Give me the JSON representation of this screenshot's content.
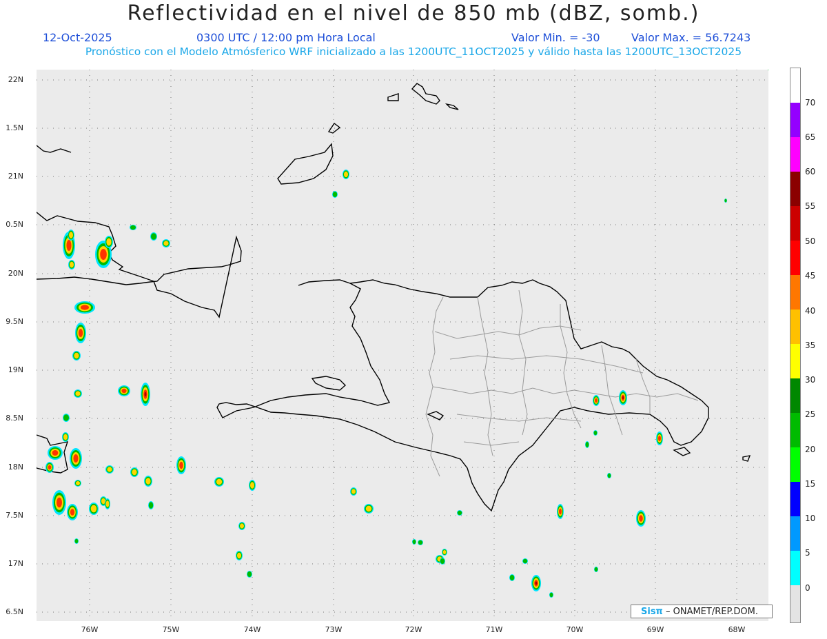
{
  "header": {
    "title": "Reflectividad en el nivel de 850 mb (dBZ, somb.)",
    "date": "12-Oct-2025",
    "time": "0300 UTC / 12:00 pm Hora Local",
    "min_label": "Valor Min. = -30",
    "max_label": "Valor Max. = 56.7243",
    "forecast_note": "Pronóstico con el Modelo Atmósferico WRF inicializado a las 1200UTC_11OCT2025 y válido hasta las  1200UTC_13OCT2025"
  },
  "map": {
    "background": "#ebebeb",
    "coast_color": "#000000",
    "province_color": "#9a9a9a",
    "lon_labels": [
      "76W",
      "75W",
      "74W",
      "73W",
      "72W",
      "71W",
      "70W",
      "69W",
      "68W"
    ],
    "lat_labels": [
      "22N",
      "1.5N",
      "21N",
      "0.5N",
      "20N",
      "9.5N",
      "19N",
      "8.5N",
      "18N",
      "7.5N",
      "17N",
      "6.5N"
    ]
  },
  "colorbar": {
    "labels": [
      "70",
      "65",
      "60",
      "55",
      "50",
      "45",
      "40",
      "35",
      "30",
      "25",
      "20",
      "15",
      "10",
      "5",
      "0"
    ],
    "colors": [
      "#9400ff",
      "#ff00ff",
      "#8b0000",
      "#cc0000",
      "#ff0000",
      "#ff7700",
      "#ffc000",
      "#ffff00",
      "#008800",
      "#00bb00",
      "#00ff00",
      "#0000ff",
      "#0099ff",
      "#00ffff"
    ]
  },
  "credit": {
    "logo": "Sisπ",
    "text": "– ONAMET/REP.DOM."
  }
}
